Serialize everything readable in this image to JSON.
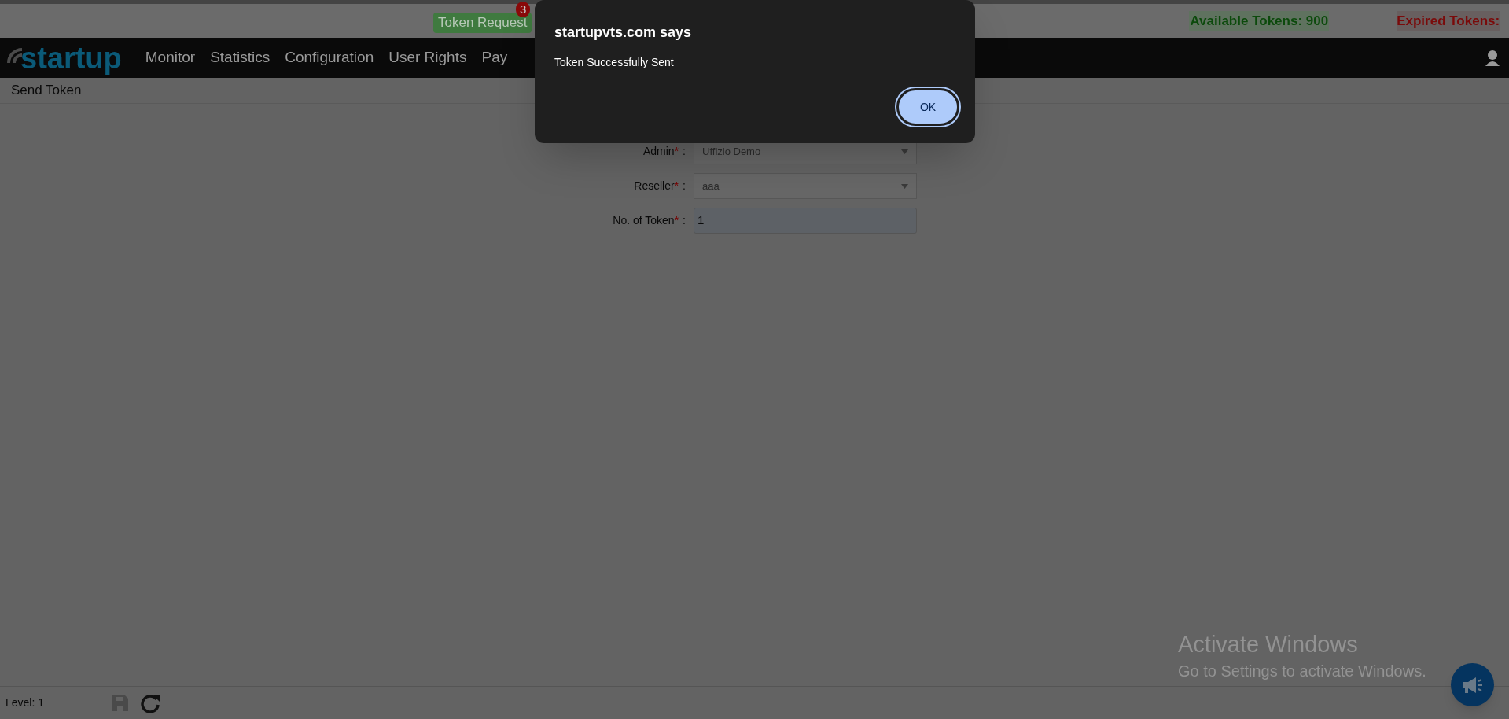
{
  "top_bar": {
    "token_request": {
      "label": "Token Request",
      "badge": "3"
    },
    "available_tokens": "Available Tokens: 900",
    "expired_tokens": "Expired Tokens:"
  },
  "nav": {
    "logo": "startup",
    "items": [
      "Monitor",
      "Statistics",
      "Configuration",
      "User Rights",
      "Pay"
    ]
  },
  "breadcrumb": "Send Token",
  "form": {
    "fields": [
      {
        "kind": "select",
        "label": "Admin",
        "required_mark": "*",
        "separator": ":",
        "value": "Uffizio Demo"
      },
      {
        "kind": "select",
        "label": "Reseller",
        "required_mark": "*",
        "separator": ":",
        "value": "aaa"
      },
      {
        "kind": "input",
        "label": "No. of Token",
        "required_mark": "*",
        "separator": ":",
        "value": "1"
      }
    ]
  },
  "dialog": {
    "title": "startupvts.com says",
    "message": "Token Successfully Sent",
    "button": "OK"
  },
  "status_bar": {
    "level": "Level: 1"
  },
  "os_notice": {
    "title": "Activate Windows",
    "subtitle": "Go to Settings to activate Windows."
  }
}
